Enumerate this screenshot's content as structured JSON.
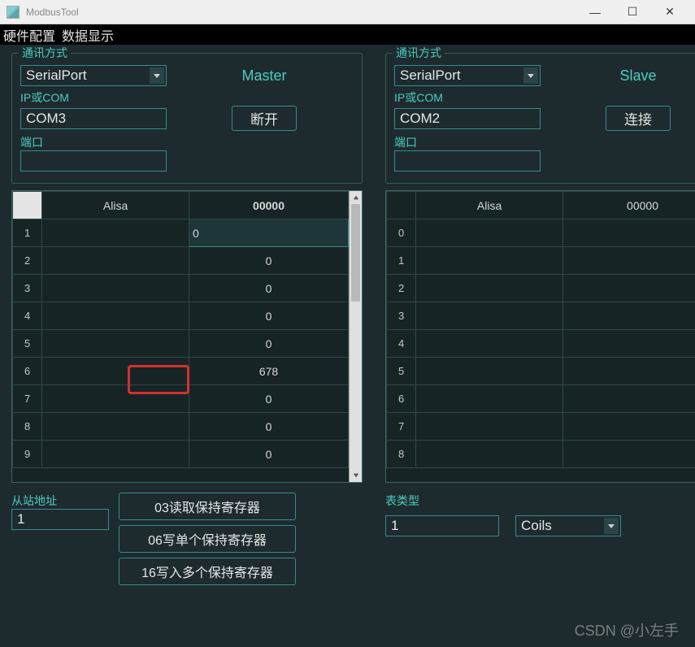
{
  "window": {
    "title": "ModbusTool"
  },
  "menu": {
    "item1": "硬件配置",
    "item2": "数据显示"
  },
  "left": {
    "group_title": "通讯方式",
    "protocol": "SerialPort",
    "ip_label": "IP或COM",
    "ip_value": "COM3",
    "port_label": "端口",
    "port_value": "",
    "mode": "Master",
    "connect_btn": "断开",
    "table": {
      "col1": "Alisa",
      "col2": "00000",
      "rows": [
        {
          "idx": "1",
          "v": "0"
        },
        {
          "idx": "2",
          "v": "0"
        },
        {
          "idx": "3",
          "v": "0"
        },
        {
          "idx": "4",
          "v": "0"
        },
        {
          "idx": "5",
          "v": "0"
        },
        {
          "idx": "6",
          "v": "678"
        },
        {
          "idx": "7",
          "v": "0"
        },
        {
          "idx": "8",
          "v": "0"
        },
        {
          "idx": "9",
          "v": "0"
        }
      ]
    },
    "slave_addr_label": "从站地址",
    "slave_addr_value": "1",
    "btn03": "03读取保持寄存器",
    "btn06": "06写单个保持寄存器",
    "btn16": "16写入多个保持寄存器"
  },
  "right": {
    "group_title": "通讯方式",
    "protocol": "SerialPort",
    "ip_label": "IP或COM",
    "ip_value": "COM2",
    "port_label": "端口",
    "port_value": "",
    "mode": "Slave",
    "connect_btn": "连接",
    "table": {
      "col1": "Alisa",
      "col2": "00000",
      "rows": [
        {
          "idx": "0",
          "v": ""
        },
        {
          "idx": "1",
          "v": ""
        },
        {
          "idx": "2",
          "v": ""
        },
        {
          "idx": "3",
          "v": ""
        },
        {
          "idx": "4",
          "v": ""
        },
        {
          "idx": "5",
          "v": ""
        },
        {
          "idx": "6",
          "v": ""
        },
        {
          "idx": "7",
          "v": ""
        },
        {
          "idx": "8",
          "v": ""
        }
      ]
    },
    "type_label": "表类型",
    "type_input": "1",
    "type_select": "Coils"
  },
  "watermark": "CSDN @小左手"
}
